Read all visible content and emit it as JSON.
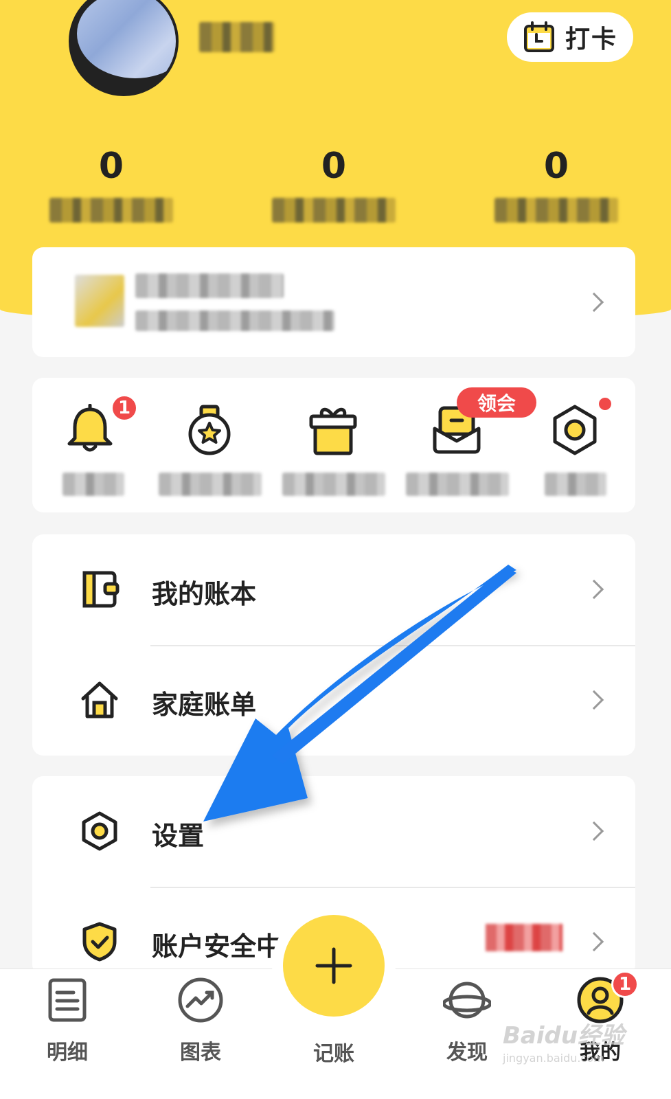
{
  "header": {
    "checkin_label": "打卡",
    "stats": [
      {
        "value": "0"
      },
      {
        "value": "0"
      },
      {
        "value": "0"
      }
    ]
  },
  "shortcuts": {
    "notification_badge": "1",
    "member_pill": "领会"
  },
  "menu": {
    "group1": [
      {
        "label": "我的账本",
        "icon": "ledger-icon"
      },
      {
        "label": "家庭账单",
        "icon": "home-icon"
      }
    ],
    "group2": [
      {
        "label": "设置",
        "icon": "settings-icon"
      },
      {
        "label": "账户安全中",
        "icon": "shield-check-icon"
      }
    ]
  },
  "tabbar": {
    "tabs": [
      {
        "label": "明细",
        "icon": "list-icon"
      },
      {
        "label": "图表",
        "icon": "chart-icon"
      },
      {
        "label": "记账",
        "icon": "plus-icon"
      },
      {
        "label": "发现",
        "icon": "planet-icon"
      },
      {
        "label": "我的",
        "icon": "user-icon"
      }
    ],
    "mine_badge": "1"
  },
  "watermark": {
    "brand": "Baidu经验",
    "url": "jingyan.baidu.com"
  },
  "colors": {
    "brand_yellow": "#fddb47",
    "badge_red": "#f04a4a",
    "annotation_blue": "#1e7bf0"
  }
}
